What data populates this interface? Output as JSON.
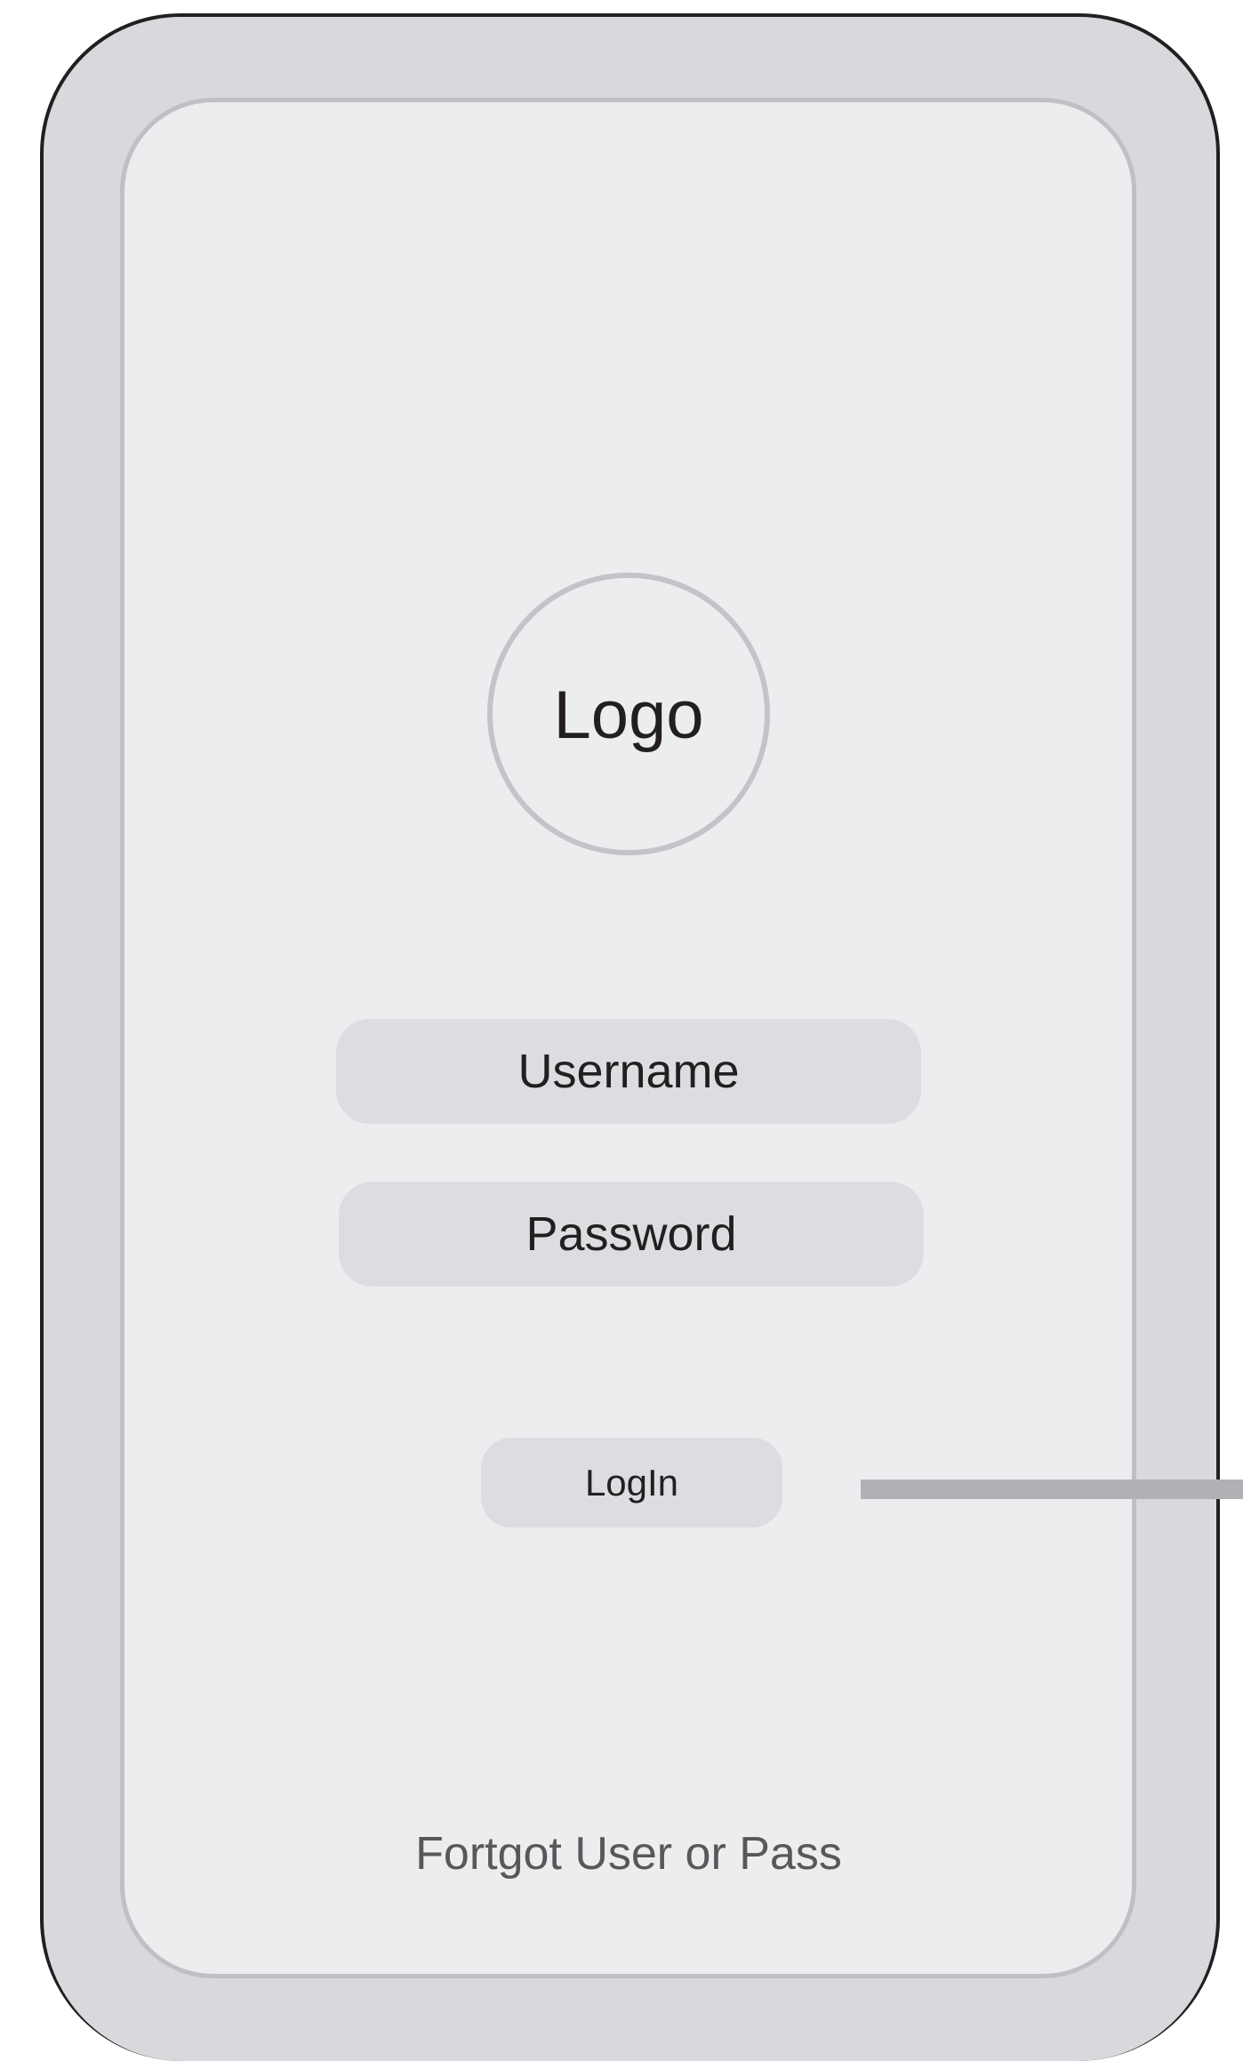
{
  "logo": {
    "label": "Logo"
  },
  "login_form": {
    "username_placeholder": "Username",
    "password_placeholder": "Password",
    "login_label": "LogIn"
  },
  "footer": {
    "forgot_label": "Fortgot User or Pass"
  },
  "colors": {
    "frame": "#d8d9dc",
    "frame_border": "#231f20",
    "screen": "#ecedef",
    "screen_border": "#bfc0c4",
    "field": "#dcdde0",
    "text": "#231f20",
    "link_text": "#58585b",
    "connector": "#b1b1b5"
  }
}
